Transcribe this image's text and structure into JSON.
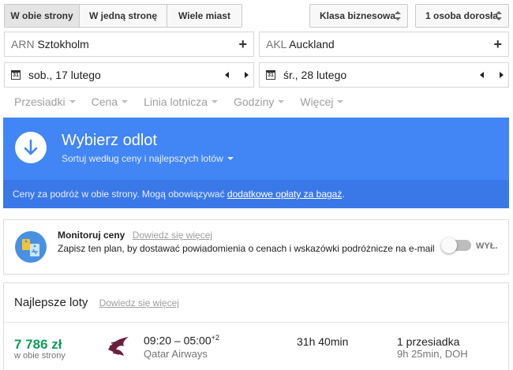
{
  "trip_tabs": [
    "W obie strony",
    "W jedną stronę",
    "Wiele miast"
  ],
  "cabin_class": "Klasa biznesowa",
  "passengers": "1 osoba dorosła",
  "origin": {
    "code": "ARN",
    "city": "Sztokholm"
  },
  "destination": {
    "code": "AKL",
    "city": "Auckland"
  },
  "depart_date": "sob., 17 lutego",
  "return_date": "śr., 28 lutego",
  "calendar_icon_text": "31",
  "filters": [
    "Przesiadki",
    "Cena",
    "Linia lotnicza",
    "Godziny",
    "Więcej"
  ],
  "banner": {
    "title": "Wybierz odlot",
    "subtitle": "Sortuj według ceny i najlepszych lotów",
    "note_prefix": "Ceny za podróż w obie strony. Mogą obowiązywać ",
    "note_link": "dodatkowe opłaty za bagaż",
    "note_suffix": "."
  },
  "monitor": {
    "title": "Monitoruj ceny",
    "learn_more": "Dowiedz się więcej",
    "description": "Zapisz ten plan, by dostawać powiadomienia o cenach i wskazówki podróżnicze na e-mail",
    "toggle_label": "WYŁ.",
    "toggle_on": false
  },
  "best_flights": {
    "title": "Najlepsze loty",
    "learn_more": "Dowiedz się więcej",
    "flights": [
      {
        "price": "7 786 zł",
        "price_note": "w obie strony",
        "times": "09:20 – 05:00",
        "day_offset": "+2",
        "airline": "Qatar Airways",
        "duration": "31h 40min",
        "stops": "1 przesiadka",
        "stop_detail": "9h 25min, DOH"
      }
    ]
  },
  "colors": {
    "accent": "#4285f4",
    "price": "#0f9d58",
    "muted": "#9e9e9e",
    "logo": "#6b1e3d"
  }
}
